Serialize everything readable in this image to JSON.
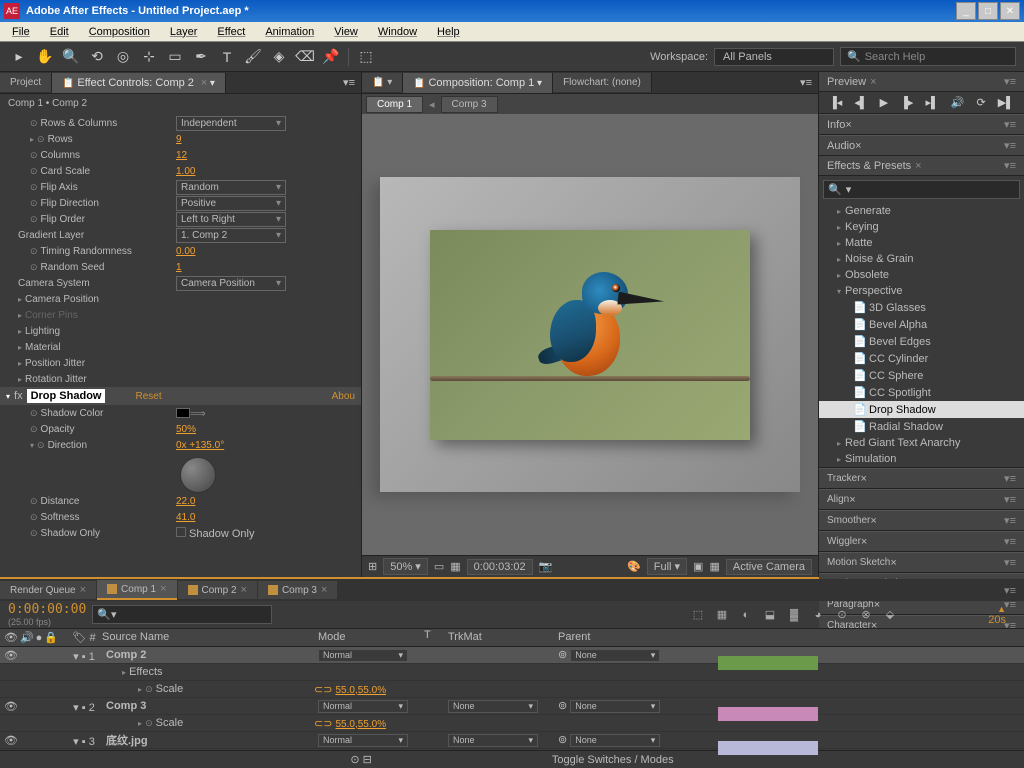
{
  "titlebar": {
    "app": "Adobe After Effects",
    "project": "Untitled Project.aep *"
  },
  "menu": [
    "File",
    "Edit",
    "Composition",
    "Layer",
    "Effect",
    "Animation",
    "View",
    "Window",
    "Help"
  ],
  "workspace": {
    "label": "Workspace:",
    "value": "All Panels"
  },
  "search": {
    "placeholder": "Search Help"
  },
  "left": {
    "tabs": {
      "project": "Project",
      "effect_controls": "Effect Controls: Comp 2"
    },
    "breadcrumb": "Comp 1 • Comp 2",
    "props": [
      {
        "label": "Rows & Columns",
        "type": "dd",
        "value": "Independent",
        "indent": 2
      },
      {
        "label": "Rows",
        "type": "val",
        "value": "9",
        "indent": 2,
        "tri": true
      },
      {
        "label": "Columns",
        "type": "val",
        "value": "12",
        "indent": 2
      },
      {
        "label": "Card Scale",
        "type": "val",
        "value": "1.00",
        "indent": 2
      },
      {
        "label": "Flip Axis",
        "type": "dd",
        "value": "Random",
        "indent": 2
      },
      {
        "label": "Flip Direction",
        "type": "dd",
        "value": "Positive",
        "indent": 2
      },
      {
        "label": "Flip Order",
        "type": "dd",
        "value": "Left to Right",
        "indent": 2
      },
      {
        "label": "Gradient Layer",
        "type": "dd",
        "value": "1. Comp 2",
        "indent": 1,
        "nostop": true
      },
      {
        "label": "Timing Randomness",
        "type": "val",
        "value": "0.00",
        "indent": 2
      },
      {
        "label": "Random Seed",
        "type": "val",
        "value": "1",
        "indent": 2
      },
      {
        "label": "Camera System",
        "type": "dd",
        "value": "Camera Position",
        "indent": 1,
        "nostop": true
      },
      {
        "label": "Camera Position",
        "type": "group",
        "indent": 1
      },
      {
        "label": "Corner Pins",
        "type": "group",
        "indent": 1,
        "dim": true
      },
      {
        "label": "Lighting",
        "type": "group",
        "indent": 1
      },
      {
        "label": "Material",
        "type": "group",
        "indent": 1
      },
      {
        "label": "Position Jitter",
        "type": "group",
        "indent": 1
      },
      {
        "label": "Rotation Jitter",
        "type": "group",
        "indent": 1
      }
    ],
    "fx": {
      "name": "Drop Shadow",
      "reset": "Reset",
      "about": "Abou",
      "rows": [
        {
          "label": "Shadow Color",
          "type": "color"
        },
        {
          "label": "Opacity",
          "type": "val",
          "value": "50%"
        },
        {
          "label": "Direction",
          "type": "knob",
          "value": "0x +135.0°"
        },
        {
          "label": "Distance",
          "type": "val",
          "value": "22.0"
        },
        {
          "label": "Softness",
          "type": "val",
          "value": "41.0"
        },
        {
          "label": "Shadow Only",
          "type": "check",
          "value": "Shadow Only"
        }
      ]
    }
  },
  "center": {
    "tabs": {
      "comp": "Composition: Comp 1",
      "flow": "Flowchart: (none)"
    },
    "viewer_tabs": [
      "Comp 1",
      "Comp 3"
    ],
    "controls": {
      "zoom": "50%",
      "time": "0:00:03:02",
      "quality": "Full",
      "view": "Active Camera"
    }
  },
  "right": {
    "preview": "Preview",
    "info": "Info",
    "audio": "Audio",
    "ep": {
      "title": "Effects & Presets",
      "search": "",
      "tree": [
        {
          "label": "Generate",
          "tri": true
        },
        {
          "label": "Keying",
          "tri": true
        },
        {
          "label": "Matte",
          "tri": true
        },
        {
          "label": "Noise & Grain",
          "tri": true
        },
        {
          "label": "Obsolete",
          "tri": true
        },
        {
          "label": "Perspective",
          "tri": true,
          "open": true
        },
        {
          "label": "3D Glasses",
          "sub": true
        },
        {
          "label": "Bevel Alpha",
          "sub": true
        },
        {
          "label": "Bevel Edges",
          "sub": true
        },
        {
          "label": "CC Cylinder",
          "sub": true
        },
        {
          "label": "CC Sphere",
          "sub": true
        },
        {
          "label": "CC Spotlight",
          "sub": true
        },
        {
          "label": "Drop Shadow",
          "sub": true,
          "sel": true
        },
        {
          "label": "Radial Shadow",
          "sub": true
        },
        {
          "label": "Red Giant Text Anarchy",
          "tri": true
        },
        {
          "label": "Simulation",
          "tri": true
        }
      ]
    },
    "collapsed": [
      "Tracker",
      "Align",
      "Smoother",
      "Wiggler",
      "Motion Sketch",
      "Mask Interpolation",
      "Paragraph",
      "Character"
    ]
  },
  "timeline": {
    "tabs": [
      {
        "label": "Render Queue"
      },
      {
        "label": "Comp 1",
        "active": true,
        "sq": true
      },
      {
        "label": "Comp 2",
        "sq": true
      },
      {
        "label": "Comp 3",
        "sq": true
      }
    ],
    "timecode": "0:00:00:00",
    "fps": "(25.00 fps)",
    "headers": {
      "source": "Source Name",
      "mode": "Mode",
      "t": "T",
      "trk": "TrkMat",
      "parent": "Parent"
    },
    "layers": [
      {
        "num": "1",
        "name": "Comp 2",
        "mode": "Normal",
        "trk": "",
        "parent": "None",
        "sel": true,
        "bar": "green"
      },
      {
        "sub": "Effects"
      },
      {
        "sub": "Scale",
        "value": "55.0,55.0%"
      },
      {
        "num": "2",
        "name": "Comp 3",
        "mode": "Normal",
        "trk": "None",
        "parent": "None",
        "bar": "pink"
      },
      {
        "sub": "Scale",
        "value": "55.0,55.0%"
      },
      {
        "num": "3",
        "name": "底纹.jpg",
        "mode": "Normal",
        "trk": "None",
        "parent": "None",
        "bar": "lav"
      }
    ],
    "footer": "Toggle Switches / Modes",
    "marker": "20s"
  }
}
